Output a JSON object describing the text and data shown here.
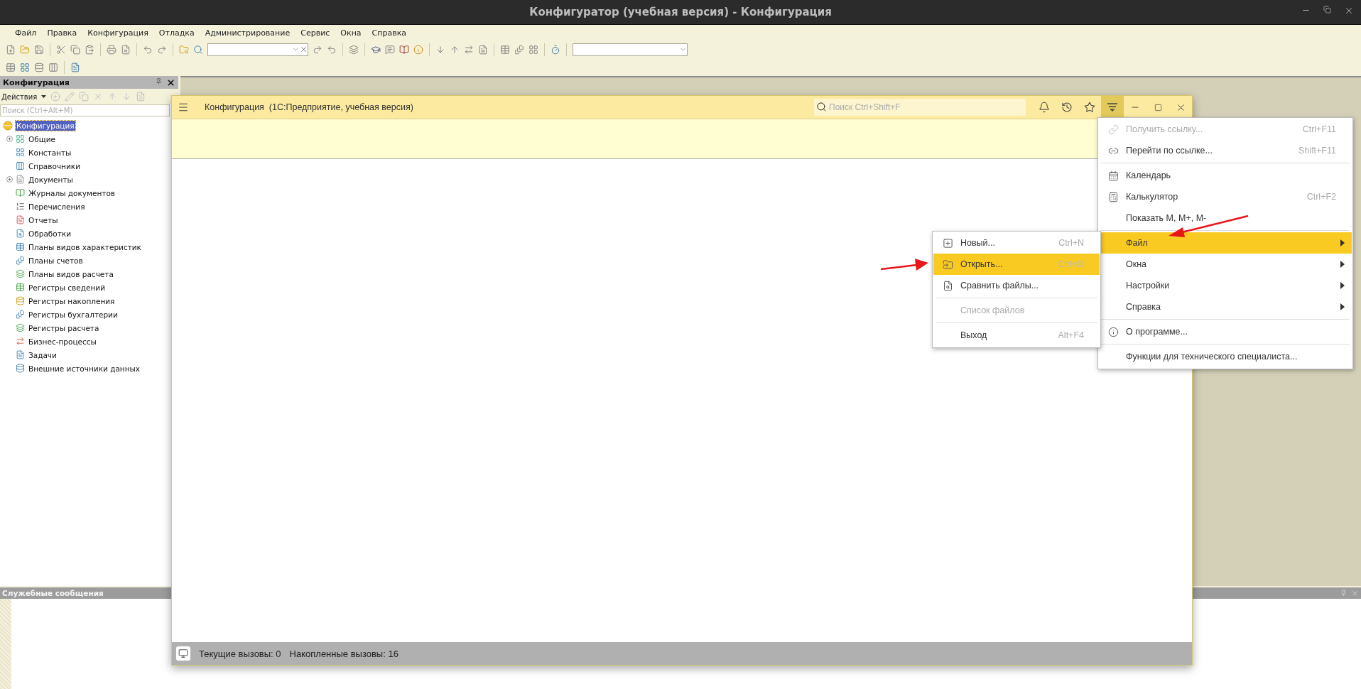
{
  "window": {
    "title": "Конфигуратор (учебная версия) - Конфигурация"
  },
  "menu_bar": [
    {
      "label": "Файл"
    },
    {
      "label": "Правка"
    },
    {
      "label": "Конфигурация"
    },
    {
      "label": "Отладка"
    },
    {
      "label": "Администрирование"
    },
    {
      "label": "Сервис"
    },
    {
      "label": "Окна"
    },
    {
      "label": "Справка"
    }
  ],
  "config_panel": {
    "title": "Конфигурация",
    "actions_label": "Действия",
    "search": {
      "placeholder": "Поиск (Ctrl+Alt+M)"
    },
    "tree": [
      {
        "label": "Конфигурация",
        "kind": "root",
        "selected": true,
        "children": [
          {
            "label": "Общие",
            "kind": "common",
            "selected": false,
            "expandable": true
          },
          {
            "label": "Константы",
            "kind": "constants",
            "selected": false,
            "expandable": false
          },
          {
            "label": "Справочники",
            "kind": "catalogs",
            "selected": false,
            "expandable": false
          },
          {
            "label": "Документы",
            "kind": "documents",
            "selected": false,
            "expandable": true
          },
          {
            "label": "Журналы документов",
            "kind": "journals",
            "selected": false,
            "expandable": false
          },
          {
            "label": "Перечисления",
            "kind": "enums",
            "selected": false,
            "expandable": false
          },
          {
            "label": "Отчеты",
            "kind": "reports",
            "selected": false,
            "expandable": false
          },
          {
            "label": "Обработки",
            "kind": "processors",
            "selected": false,
            "expandable": false
          },
          {
            "label": "Планы видов характеристик",
            "kind": "grid",
            "selected": false,
            "expandable": false
          },
          {
            "label": "Планы счетов",
            "kind": "accounts",
            "selected": false,
            "expandable": false
          },
          {
            "label": "Планы видов расчета",
            "kind": "layers",
            "selected": false,
            "expandable": false
          },
          {
            "label": "Регистры сведений",
            "kind": "table",
            "selected": false,
            "expandable": false
          },
          {
            "label": "Регистры накопления",
            "kind": "coins",
            "selected": false,
            "expandable": false
          },
          {
            "label": "Регистры бухгалтерии",
            "kind": "accounts",
            "selected": false,
            "expandable": false
          },
          {
            "label": "Регистры расчета",
            "kind": "layers",
            "selected": false,
            "expandable": false
          },
          {
            "label": "Бизнес-процессы",
            "kind": "process",
            "selected": false,
            "expandable": false
          },
          {
            "label": "Задачи",
            "kind": "tasks",
            "selected": false,
            "expandable": false
          },
          {
            "label": "Внешние источники данных",
            "kind": "external",
            "selected": false,
            "expandable": false
          }
        ]
      }
    ]
  },
  "messages_panel": {
    "title": "Служебные сообщения"
  },
  "app_window": {
    "title": "Конфигурация  (1С:Предприятие, учебная версия)",
    "search": {
      "placeholder": "Поиск Ctrl+Shift+F"
    },
    "menu_open": true,
    "status_bar": [
      "Текущие вызовы: 0",
      "Накопленные вызовы: 16"
    ]
  },
  "main_menu": {
    "groups": [
      [
        {
          "label": "Получить ссылку...",
          "shortcut": "Ctrl+F11",
          "kind": "link",
          "disabled": true,
          "selected": false
        },
        {
          "label": "Перейти по ссылке...",
          "shortcut": "Shift+F11",
          "kind": "goto",
          "disabled": false,
          "selected": false
        }
      ],
      [
        {
          "label": "Календарь",
          "kind": "calendar",
          "disabled": false,
          "selected": false
        },
        {
          "label": "Калькулятор",
          "shortcut": "Ctrl+F2",
          "kind": "calculator",
          "disabled": false,
          "selected": false
        },
        {
          "label": "Показать M, M+, M-",
          "kind": "plain",
          "disabled": false,
          "selected": false
        }
      ],
      [
        {
          "label": "Файл",
          "kind": "submenu",
          "disabled": false,
          "selected": true
        },
        {
          "label": "Окна",
          "kind": "submenu",
          "disabled": false,
          "selected": false
        },
        {
          "label": "Настройки",
          "kind": "submenu",
          "disabled": false,
          "selected": false
        },
        {
          "label": "Справка",
          "kind": "submenu",
          "disabled": false,
          "selected": false
        }
      ],
      [
        {
          "label": "О программе...",
          "kind": "about",
          "disabled": false,
          "selected": false
        }
      ],
      [
        {
          "label": "Функции для технического специалиста...",
          "kind": "plain",
          "disabled": false,
          "selected": false
        }
      ]
    ]
  },
  "file_menu": {
    "groups": [
      [
        {
          "label": "Новый...",
          "shortcut": "Ctrl+N",
          "kind": "new",
          "disabled": false,
          "selected": false
        },
        {
          "label": "Открыть...",
          "shortcut": "Ctrl+O",
          "kind": "open",
          "disabled": false,
          "selected": true
        },
        {
          "label": "Сравнить файлы...",
          "kind": "compare",
          "disabled": false,
          "selected": false
        }
      ],
      [
        {
          "label": "Список файлов",
          "kind": "plain",
          "disabled": true,
          "selected": false
        }
      ],
      [
        {
          "label": "Выход",
          "shortcut": "Alt+F4",
          "kind": "plain",
          "disabled": false,
          "selected": false
        }
      ]
    ]
  }
}
